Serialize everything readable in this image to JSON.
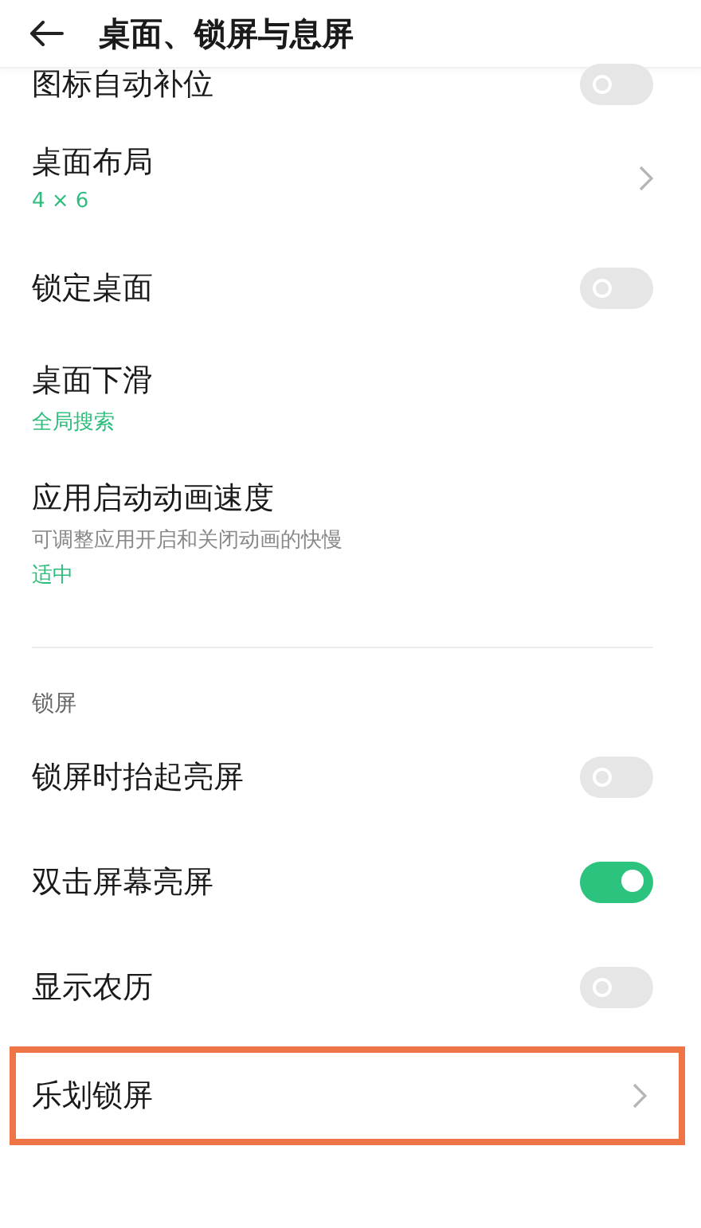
{
  "header": {
    "title": "桌面、锁屏与息屏"
  },
  "sections": [
    {
      "items": [
        {
          "kind": "toggle",
          "title": "图标自动补位",
          "on": false
        },
        {
          "kind": "link",
          "title": "桌面布局",
          "value": "4 × 6"
        },
        {
          "kind": "toggle",
          "title": "锁定桌面",
          "on": false
        },
        {
          "kind": "link",
          "title": "桌面下滑",
          "value": "全局搜索",
          "chevron": false
        },
        {
          "kind": "link",
          "title": "应用启动动画速度",
          "subtitle": "可调整应用开启和关闭动画的快慢",
          "value": "适中",
          "chevron": false
        }
      ]
    },
    {
      "header": "锁屏",
      "items": [
        {
          "kind": "toggle",
          "title": "锁屏时抬起亮屏",
          "on": false
        },
        {
          "kind": "toggle",
          "title": "双击屏幕亮屏",
          "on": true
        },
        {
          "kind": "toggle",
          "title": "显示农历",
          "on": false
        },
        {
          "kind": "link",
          "title": "乐划锁屏",
          "highlighted": true
        }
      ]
    }
  ]
}
